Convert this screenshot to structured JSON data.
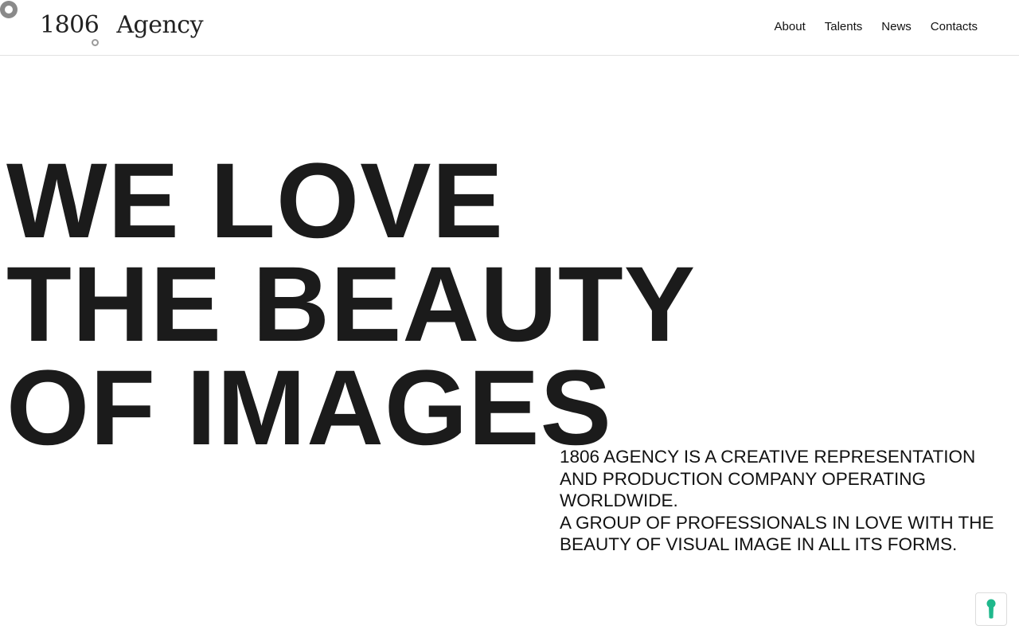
{
  "header": {
    "logo": {
      "number": "1806",
      "word": "Agency"
    },
    "nav": [
      {
        "label": "About"
      },
      {
        "label": "Talents"
      },
      {
        "label": "News"
      },
      {
        "label": "Contacts"
      }
    ]
  },
  "hero": {
    "lines": [
      "WE LOVE",
      "THE BEAUTY",
      "OF IMAGES"
    ]
  },
  "intro": {
    "paragraph_1": "1806 AGENCY IS A CREATIVE REPRESENTATION AND PRODUCTION COMPANY OPERATING WORLDWIDE.",
    "paragraph_2": "A GROUP OF PROFESSIONALS IN LOVE WITH THE BEAUTY OF VISUAL IMAGE IN ALL ITS FORMS."
  },
  "cookie_widget": {
    "icon": "keyhole-icon",
    "color": "#1fb88c"
  },
  "cursor": {
    "icon": "cursor-ring-icon"
  }
}
